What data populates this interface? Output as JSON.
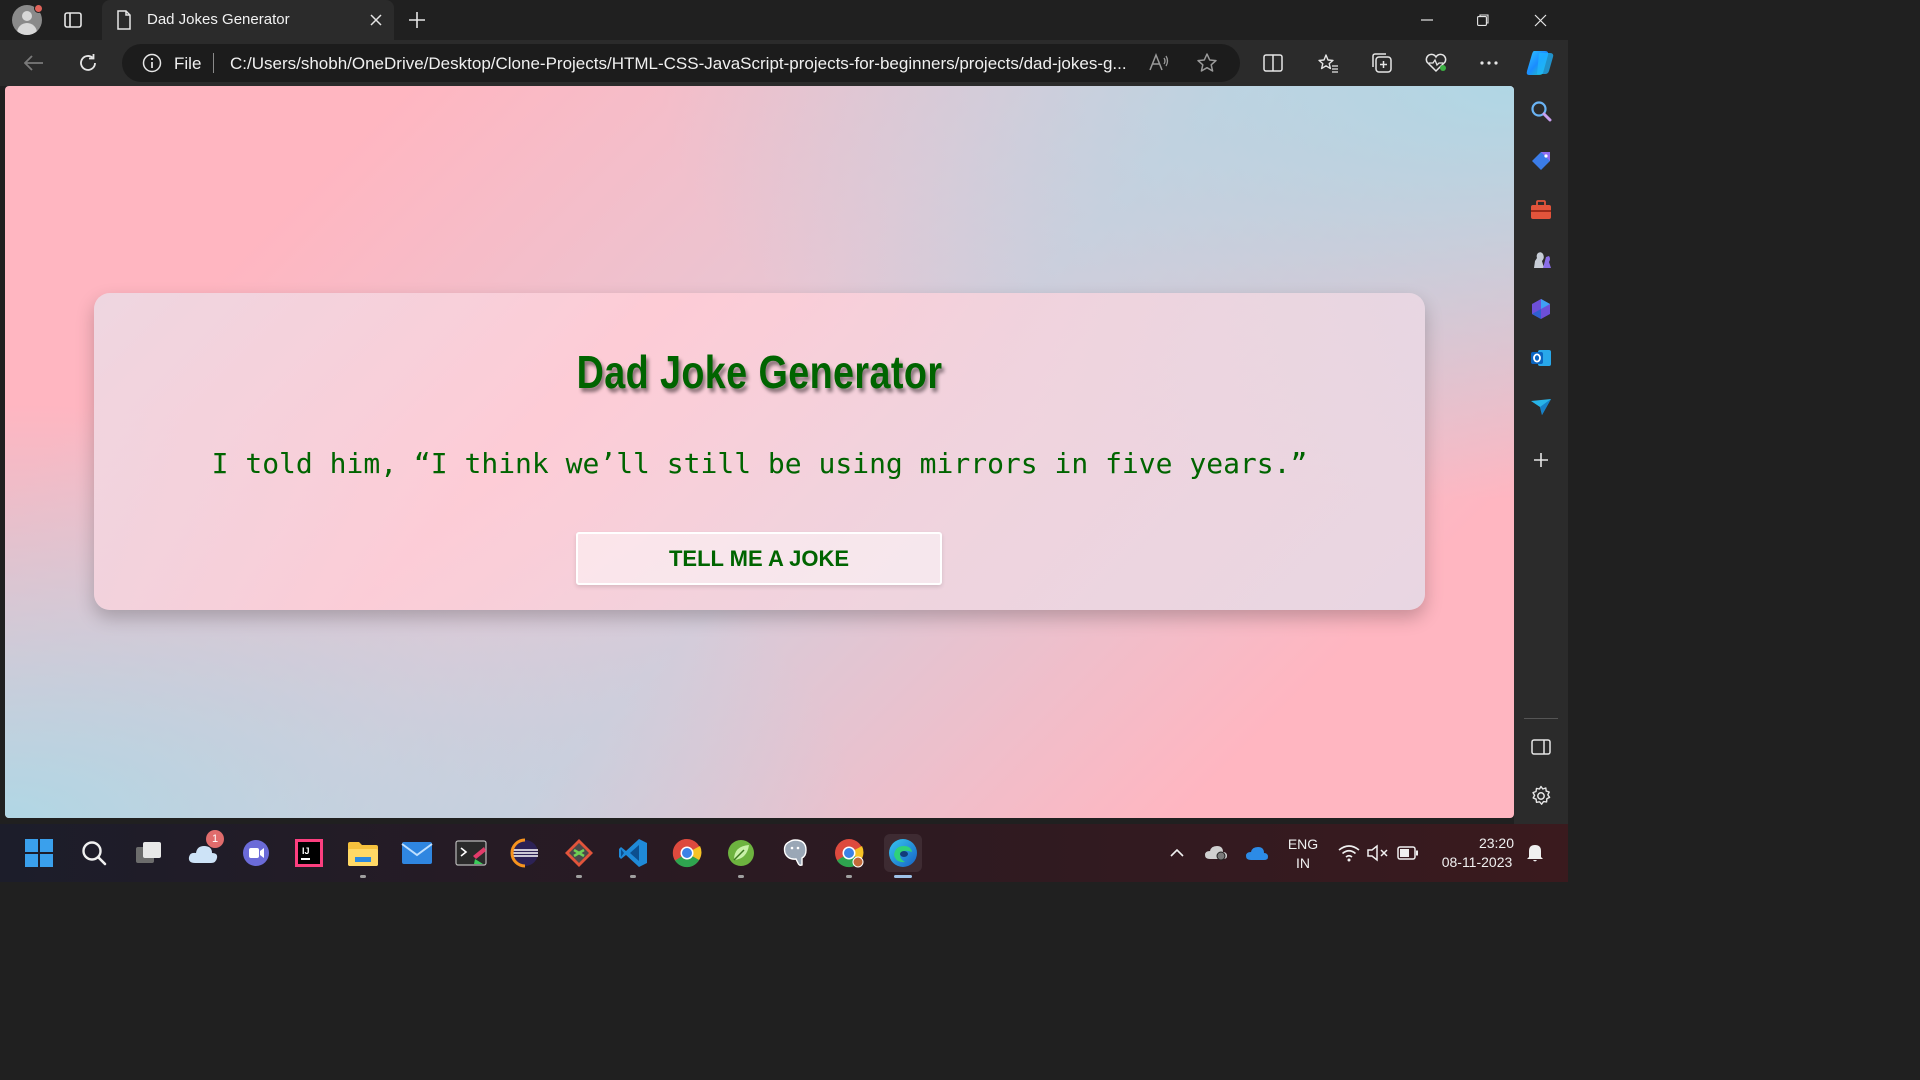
{
  "browser": {
    "tab_title": "Dad Jokes Generator",
    "address_prefix": "File",
    "url": "C:/Users/shobh/OneDrive/Desktop/Clone-Projects/HTML-CSS-JavaScript-projects-for-beginners/projects/dad-jokes-g..."
  },
  "page": {
    "heading": "Dad Joke Generator",
    "joke": "I told him, “I think we’ll still be using mirrors in five years.”",
    "button_label": "TELL ME A JOKE",
    "text_color": "#006400",
    "bg_colors": [
      "#ffb6c1",
      "#add8e6"
    ]
  },
  "taskbar": {
    "weather_badge": "1",
    "language": "ENG",
    "region": "IN",
    "time": "23:20",
    "date": "08-11-2023"
  }
}
